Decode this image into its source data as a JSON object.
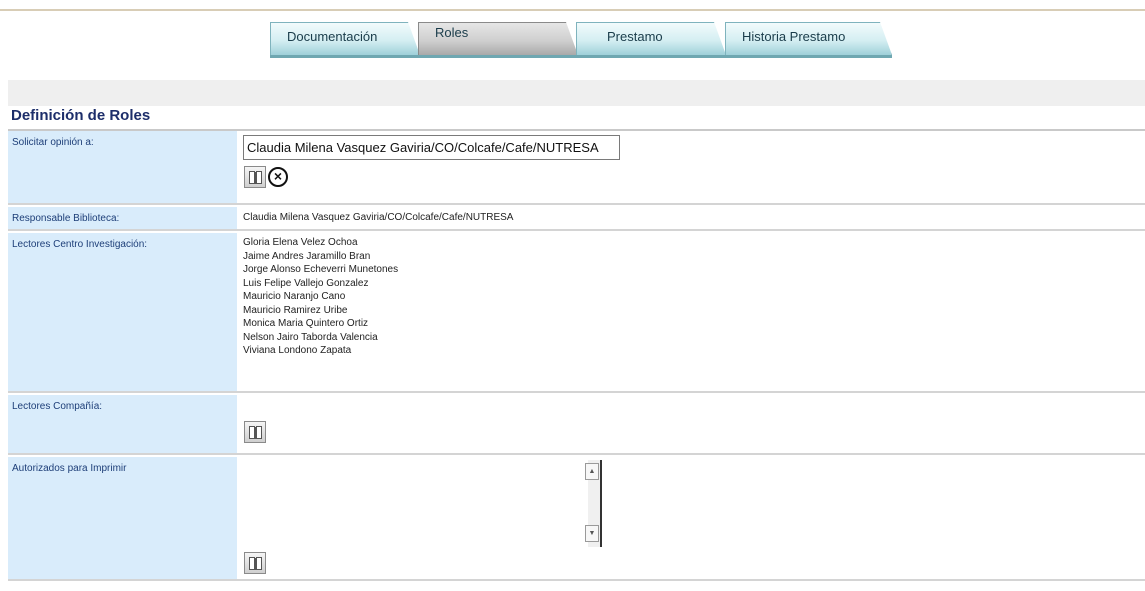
{
  "tabs": [
    {
      "label": "Documentación"
    },
    {
      "label": "Roles"
    },
    {
      "label": "Prestamo"
    },
    {
      "label": "Historia Prestamo"
    }
  ],
  "section": {
    "title": "Definición de Roles"
  },
  "fields": {
    "solicitar": {
      "label": "Solicitar opinión a:",
      "value": "Claudia Milena Vasquez Gaviria/CO/Colcafe/Cafe/NUTRESA"
    },
    "responsable": {
      "label": "Responsable Biblioteca:",
      "value": "Claudia Milena Vasquez Gaviria/CO/Colcafe/Cafe/NUTRESA"
    },
    "lectores_centro": {
      "label": "Lectores Centro Investigación:",
      "items": [
        "Gloria Elena Velez Ochoa",
        "Jaime Andres Jaramillo Bran",
        "Jorge Alonso Echeverri Munetones",
        "Luis Felipe Vallejo Gonzalez",
        "Mauricio Naranjo Cano",
        "Mauricio Ramirez Uribe",
        "Monica Maria Quintero Ortiz",
        "Nelson Jairo Taborda Valencia",
        "Viviana Londono Zapata"
      ]
    },
    "lectores_compania": {
      "label": "Lectores Compañía:"
    },
    "autorizados": {
      "label": "Autorizados para Imprimir",
      "value": ""
    }
  },
  "icons": {
    "address_book": "book-icon",
    "clear": "x-circle-icon",
    "scroll_up": "arrow-up-icon",
    "scroll_down": "arrow-down-icon"
  },
  "colors": {
    "label_bg": "#d9ecfb",
    "title": "#1d2e6a",
    "tab_active": "#cfcfcf",
    "tab_inactive": "#d4eef2"
  }
}
